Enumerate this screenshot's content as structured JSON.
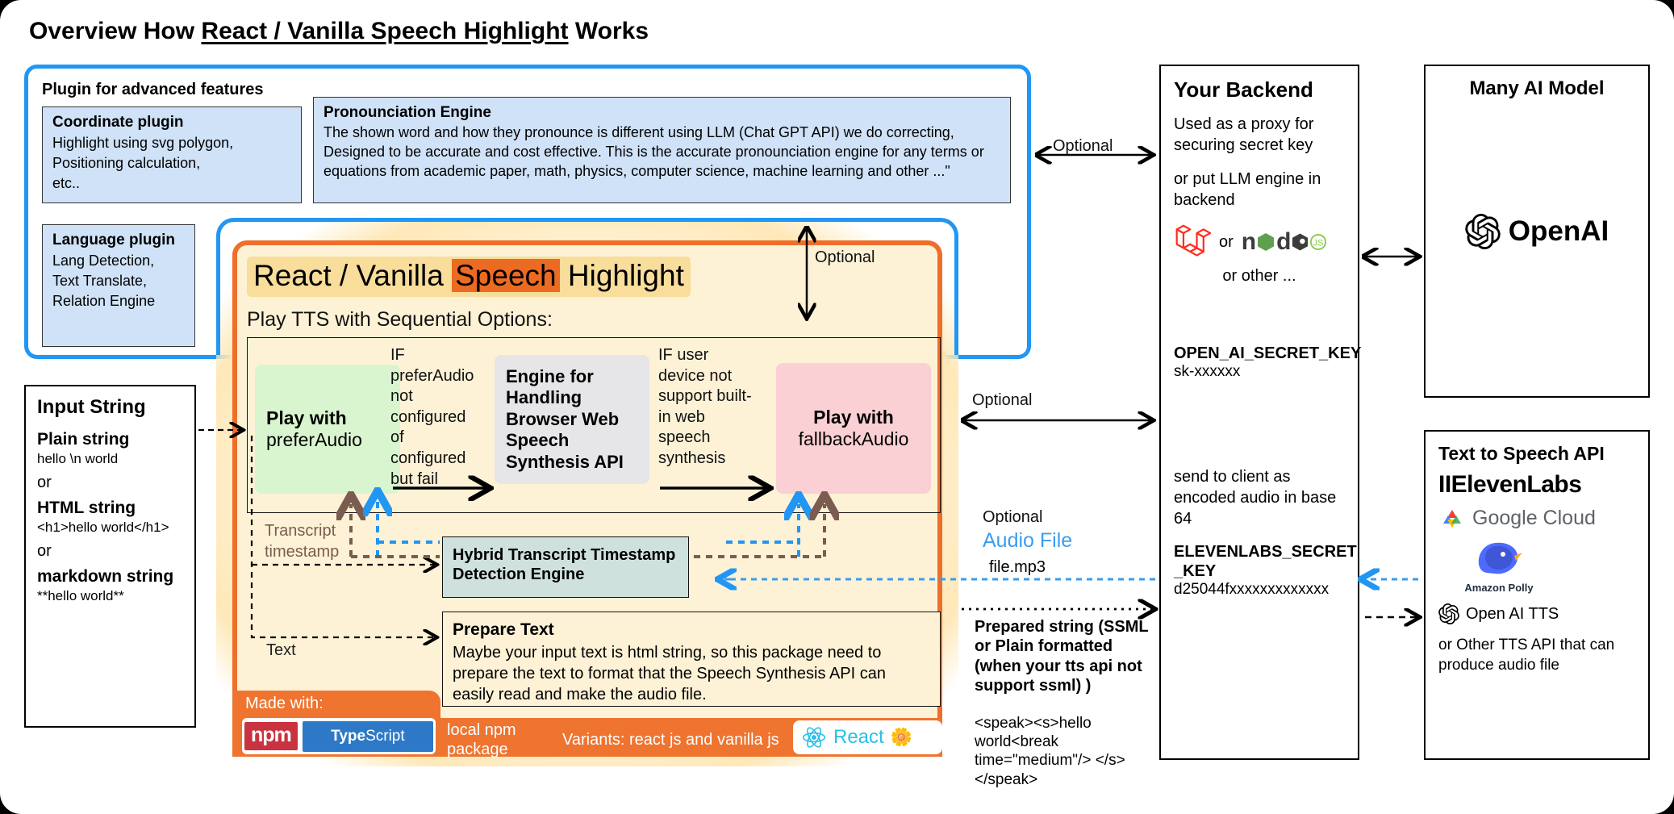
{
  "title": {
    "prefix": "Overview How ",
    "underlined": "React / Vanilla Speech Highlight",
    "suffix": " Works"
  },
  "plugin_panel": {
    "title": "Plugin for advanced features",
    "coordinate_plugin": {
      "head": "Coordinate plugin",
      "lines": [
        "Highlight using svg polygon,",
        "Positioning calculation,",
        "etc.."
      ]
    },
    "language_plugin": {
      "head": "Language plugin",
      "lines": [
        "Lang Detection,",
        "Text Translate,",
        "Relation Engine"
      ]
    },
    "pronunciation_engine": {
      "head": "Pronounciation Engine",
      "body": "The shown word and how they pronounce is different using LLM (Chat GPT API) we do correcting, Designed to be accurate and cost effective. This is the accurate pronounciation engine for any terms or equations from academic paper, math, physics, computer science, machine learning and other ...\""
    }
  },
  "input_string": {
    "header": "Input String",
    "plain_label": "Plain string",
    "plain_value": "hello \\n world",
    "or1": "or",
    "html_label": "HTML string",
    "html_value": "<h1>hello world</h1>",
    "or2": "or",
    "markdown_label": "markdown string",
    "markdown_value": "**hello world**"
  },
  "main": {
    "title_part1": "React / Vanilla ",
    "title_highlight": "Speech",
    "title_part2": " Highlight",
    "subtitle": "Play TTS with Sequential Options:",
    "play_prefer": {
      "bold": "Play with",
      "normal": "preferAudio"
    },
    "cond1": "IF preferAudio not configured of configured but fail",
    "engine_web_speech": "Engine for Handling Browser Web Speech Synthesis API",
    "cond2": "IF user device not support built-in web speech synthesis",
    "play_fallback": {
      "bold": "Play with",
      "normal": "fallbackAudio"
    },
    "transcript_label": "Transcript timestamp",
    "hybrid_engine": "Hybrid Transcript Timestamp Detection Engine",
    "prepare_text": {
      "head": "Prepare Text",
      "body": "Maybe your input text is html string, so this package need to prepare the text to format that the Speech Synthesis API can easily read and make the audio file."
    },
    "text_label_input": "Text",
    "text_label_prepare": "Text",
    "made_with": "Made with:",
    "npm_logo": "npm",
    "ts_logo_bold": "Type",
    "ts_logo_rest": "Script",
    "local_npm_package": "local npm package",
    "variants": "Variants: react js and vanilla js",
    "react_badge": "React"
  },
  "middle_labels": {
    "optional_top": "Optional",
    "optional_vertical": "Optional",
    "optional_mid": "Optional",
    "optional_audio": "Optional",
    "audio_file": "Audio File",
    "file_name": "file.mp3",
    "prepared_string": "Prepared string (SSML or Plain formatted (when your tts api not support ssml) )",
    "prepared_sample": "<speak><s>hello world<break time=\"medium\"/> </s></speak>"
  },
  "backend": {
    "header": "Your Backend",
    "p1": "Used as a proxy for securing secret key",
    "p2": "or put LLM engine in backend",
    "or": "or",
    "node_logo": "node",
    "or_other": "or other ...",
    "openai_key_name": "OPEN_AI_SECRET_KEY",
    "openai_key_value": "sk-xxxxxx",
    "send_note": "send to client as encoded audio in base 64",
    "eleven_key_name": "ELEVENLABS_SECRET _KEY",
    "eleven_key_value": "d25044fxxxxxxxxxxxxx"
  },
  "ai_model": {
    "header": "Many AI Model",
    "openai": "OpenAI"
  },
  "tts_api": {
    "header": "Text to Speech API",
    "elevenlabs": "IIElevenLabs",
    "google_cloud": "Google Cloud",
    "amazon_polly": "Amazon Polly",
    "openai_tts": "Open AI TTS",
    "other": "or Other TTS API that can produce audio file"
  },
  "colors": {
    "blue_border": "#2196f3",
    "orange_border": "#ee6e2a",
    "orange_bar": "#ee7430",
    "panel_cream": "#fdf2d6",
    "green_box": "#d9f5cf",
    "gray_box": "#e6e6e8",
    "pink_box": "#fbd0d4",
    "teal_box": "#cfe1dd",
    "light_blue_box": "#cfe2f8",
    "highlight_orange": "#ec6b22",
    "highlight_yellow": "#f8dd9b",
    "link_blue": "#3b9cf0",
    "brown_dash": "#7a5c50"
  }
}
